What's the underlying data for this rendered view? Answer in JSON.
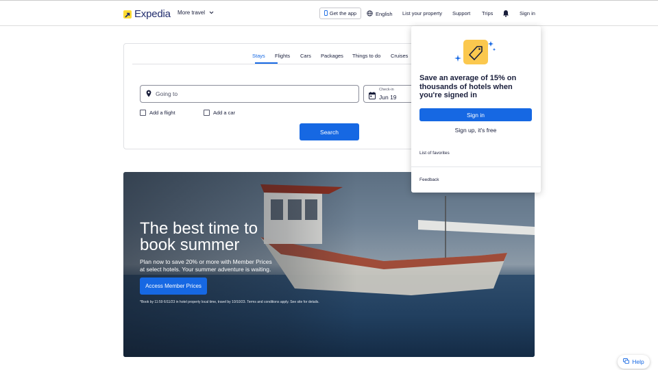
{
  "header": {
    "brand": "Expedia",
    "more_travel": "More travel",
    "get_app": "Get the app",
    "language": "English",
    "list_property": "List your property",
    "support": "Support",
    "trips": "Trips",
    "sign_in": "Sign in"
  },
  "search": {
    "tabs": [
      {
        "label": "Stays",
        "active": true
      },
      {
        "label": "Flights",
        "active": false
      },
      {
        "label": "Cars",
        "active": false
      },
      {
        "label": "Packages",
        "active": false
      },
      {
        "label": "Things to do",
        "active": false
      },
      {
        "label": "Cruises",
        "active": false
      }
    ],
    "going_to_placeholder": "Going to",
    "checkin_label": "Check-in",
    "checkin_value": "Jun 19",
    "add_flight": "Add a flight",
    "add_car": "Add a car",
    "search_button": "Search"
  },
  "hero": {
    "title": "The best time to book summer",
    "subtitle": "Plan now to save 20% or more with Member Prices at select hotels. Your summer adventure is waiting.",
    "cta": "Access Member Prices",
    "fine_print": "*Book by 11:59 6/11/23 in hotel property local time, travel by 10/10/23. Terms and conditions apply. See site for details."
  },
  "popover": {
    "title": "Save an average of 15% on thousands of hotels when you're signed in",
    "sign_in": "Sign in",
    "sign_up": "Sign up, it's free",
    "favorites": "List of favorites",
    "feedback": "Feedback"
  },
  "help": {
    "label": "Help"
  },
  "colors": {
    "accent": "#1668e3",
    "brand_yellow": "#fddb32",
    "text": "#191e3b"
  },
  "icons": [
    "expedia-logo-icon",
    "chevron-down-icon",
    "phone-icon",
    "globe-icon",
    "bell-icon",
    "map-pin-icon",
    "calendar-icon",
    "tag-sparkle-icon",
    "chat-icon"
  ]
}
